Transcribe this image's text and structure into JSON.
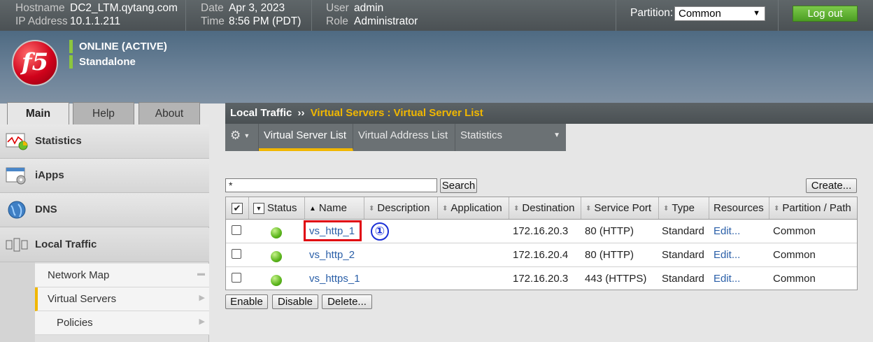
{
  "topbar": {
    "hostname_label": "Hostname",
    "hostname": "DC2_LTM.qytang.com",
    "ip_label": "IP Address",
    "ip": "10.1.1.211",
    "date_label": "Date",
    "date": "Apr 3, 2023",
    "time_label": "Time",
    "time": "8:56 PM (PDT)",
    "user_label": "User",
    "user": "admin",
    "role_label": "Role",
    "role": "Administrator",
    "partition_label": "Partition:",
    "partition_value": "Common",
    "logout_label": "Log out"
  },
  "header": {
    "logo_text": "f5",
    "status_online": "ONLINE (ACTIVE)",
    "status_mode": "Standalone"
  },
  "tabs": [
    {
      "label": "Main",
      "active": true
    },
    {
      "label": "Help",
      "active": false
    },
    {
      "label": "About",
      "active": false
    }
  ],
  "sidebar": {
    "items": [
      {
        "label": "Statistics",
        "icon": "statistics-icon"
      },
      {
        "label": "iApps",
        "icon": "iapps-icon"
      },
      {
        "label": "DNS",
        "icon": "dns-globe-icon"
      },
      {
        "label": "Local Traffic",
        "icon": "local-traffic-icon"
      }
    ],
    "sub_items": [
      {
        "label": "Network Map",
        "active": false
      },
      {
        "label": "Virtual Servers",
        "active": true
      },
      {
        "label": "Policies",
        "active": false
      }
    ]
  },
  "breadcrumb": {
    "root": "Local Traffic",
    "separator": "››",
    "path": "Virtual Servers : Virtual Server List"
  },
  "subtabs": [
    {
      "label": "Virtual Server List",
      "active": true
    },
    {
      "label": "Virtual Address List",
      "active": false
    },
    {
      "label": "Statistics",
      "active": false
    }
  ],
  "search": {
    "value": "*",
    "button": "Search"
  },
  "create_button": "Create...",
  "table": {
    "columns": [
      "Status",
      "Name",
      "Description",
      "Application",
      "Destination",
      "Service Port",
      "Type",
      "Resources",
      "Partition / Path"
    ],
    "rows": [
      {
        "name": "vs_http_1",
        "description": "",
        "application": "",
        "destination": "172.16.20.3",
        "service_port": "80 (HTTP)",
        "type": "Standard",
        "resources": "Edit...",
        "partition": "Common",
        "status": "available"
      },
      {
        "name": "vs_http_2",
        "description": "",
        "application": "",
        "destination": "172.16.20.4",
        "service_port": "80 (HTTP)",
        "type": "Standard",
        "resources": "Edit...",
        "partition": "Common",
        "status": "available"
      },
      {
        "name": "vs_https_1",
        "description": "",
        "application": "",
        "destination": "172.16.20.3",
        "service_port": "443 (HTTPS)",
        "type": "Standard",
        "resources": "Edit...",
        "partition": "Common",
        "status": "available"
      }
    ]
  },
  "annotation": {
    "marker": "①"
  },
  "actions": {
    "enable": "Enable",
    "disable": "Disable",
    "delete": "Delete..."
  },
  "colors": {
    "accent": "#f1b700",
    "online": "#8cc63f",
    "highlight": "#e0000f",
    "link": "#2a5fa8"
  }
}
